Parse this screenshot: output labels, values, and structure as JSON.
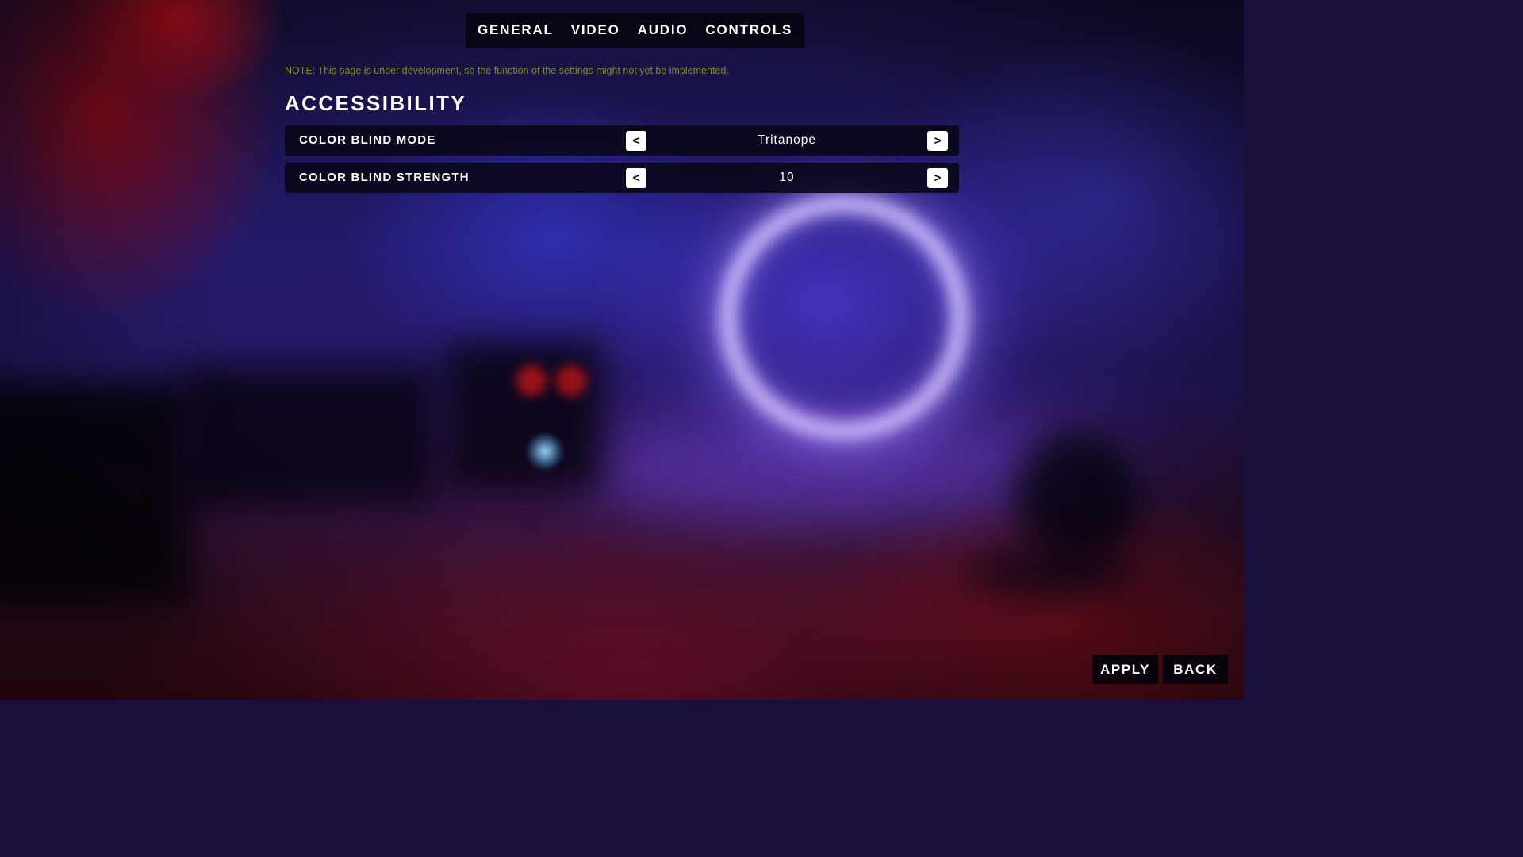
{
  "tabs": [
    {
      "label": "GENERAL"
    },
    {
      "label": "VIDEO"
    },
    {
      "label": "AUDIO"
    },
    {
      "label": "CONTROLS"
    }
  ],
  "note": "NOTE: This page is under development, so the function of the settings might not yet be implemented.",
  "section": {
    "title": "ACCESSIBILITY",
    "settings": [
      {
        "label": "COLOR BLIND MODE",
        "value": "Tritanope",
        "prev_label": "<",
        "next_label": ">"
      },
      {
        "label": "COLOR BLIND STRENGTH",
        "value": "10",
        "prev_label": "<",
        "next_label": ">"
      }
    ]
  },
  "footer": {
    "apply_label": "APPLY",
    "back_label": "BACK"
  },
  "colors": {
    "note_text": "#7f8a2c",
    "panel_bg": "#08061a",
    "text": "#ffffff"
  }
}
